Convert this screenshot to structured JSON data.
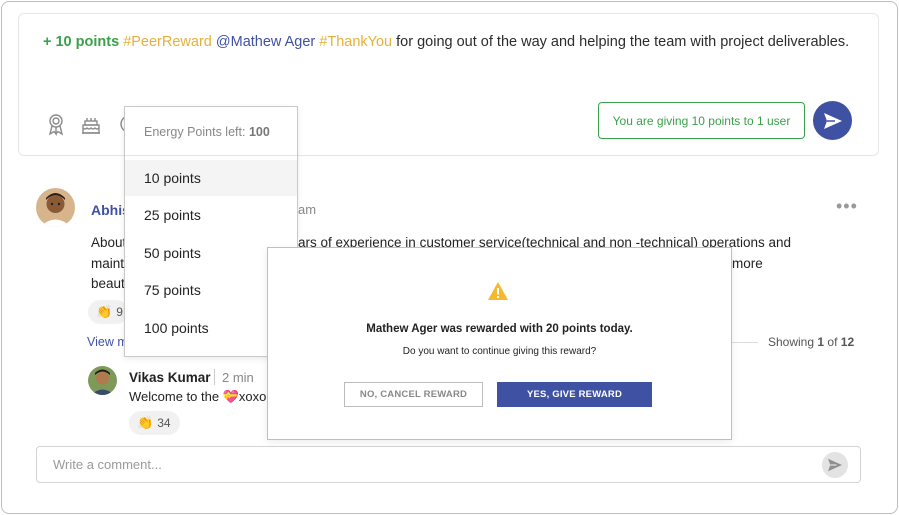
{
  "composer": {
    "points": "+ 10 points",
    "tag1": "#PeerReward",
    "mention": "@Mathew Ager",
    "tag2": "#ThankYou",
    "message": "for going out of the way and helping the team with project deliverables.",
    "giving_label": "You are giving 10 points to 1 user",
    "icons": [
      "award-icon",
      "cake-icon",
      "clock-icon"
    ]
  },
  "dropdown": {
    "header_label": "Energy Points left:",
    "header_value": "100",
    "options": [
      "10 points",
      "25 points",
      "50 points",
      "75 points",
      "100 points"
    ],
    "selected": "10 points"
  },
  "post": {
    "author_partial": "Abhis",
    "time_partial": "am",
    "lines": [
      "About",
      "maint",
      "beaut"
    ],
    "line1_tail": "ars of experience in customer service(technical and non -technical) operations and",
    "line2_tail": "more",
    "clap_count_partial": "9",
    "view_more_partial": "View m",
    "showing_prefix": "Showing",
    "showing_current": "1",
    "showing_of": "of",
    "showing_total": "12"
  },
  "reply": {
    "name": "Vikas Kumar",
    "time": "2 min",
    "text": "Welcome to the 💝xoxo",
    "clap_count": "34"
  },
  "comment": {
    "placeholder": "Write a comment..."
  },
  "modal": {
    "title": "Mathew Ager was rewarded with 20 points today.",
    "subtitle": "Do you want to continue giving this reward?",
    "cancel_label": "NO, CANCEL REWARD",
    "confirm_label": "YES, GIVE REWARD"
  },
  "colors": {
    "brand": "#3f51a3",
    "points_green": "#3aa04b",
    "hashtag_gold": "#e3b13a",
    "warning": "#f5b82e"
  }
}
